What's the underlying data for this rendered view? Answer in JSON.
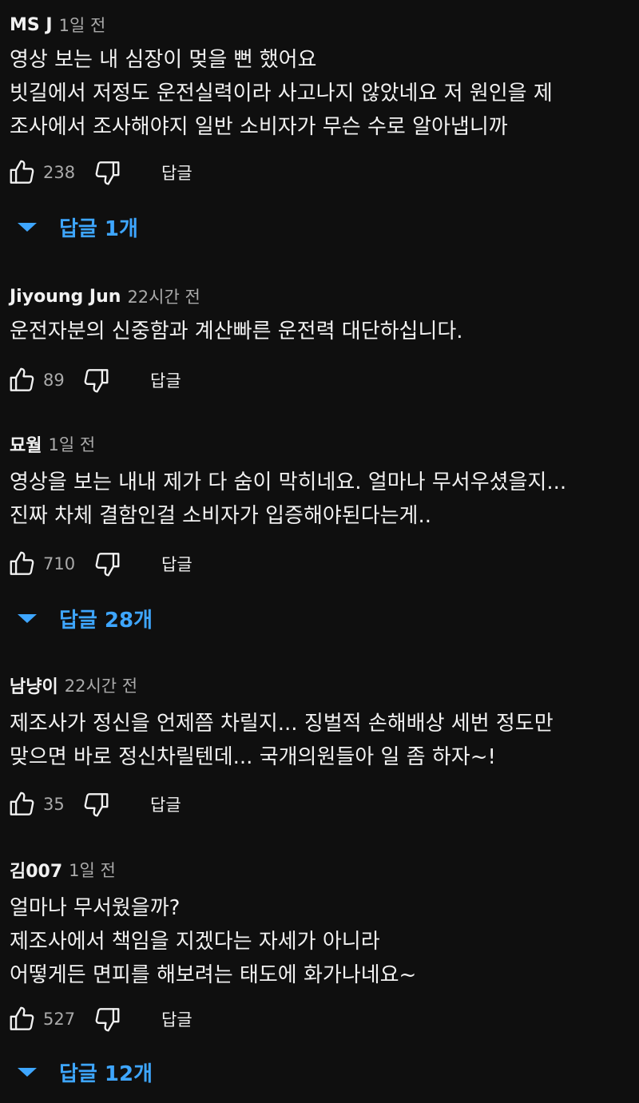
{
  "labels": {
    "reply": "답글"
  },
  "colors": {
    "background": "#0f0f0f",
    "text": "#f1f1f1",
    "secondary": "#aaaaaa",
    "link_blue": "#3ea6ff"
  },
  "icons": {
    "like": "thumbs-up-icon",
    "dislike": "thumbs-down-icon",
    "expand": "caret-down-icon"
  },
  "comments": [
    {
      "author": "MS J",
      "time": "1일 전",
      "lines": [
        "영상 보는 내 심장이 멎을 뻔 했어요",
        "빗길에서 저정도 운전실력이라 사고나지 않았네요 저 원인을 제",
        "조사에서 조사해야지 일반 소비자가 무슨 수로 알아냅니까"
      ],
      "likes": "238",
      "replies_label": "답글 1개"
    },
    {
      "author": "Jiyoung Jun",
      "time": "22시간 전",
      "lines": [
        "운전자분의 신중함과 계산빠른 운전력 대단하십니다."
      ],
      "likes": "89"
    },
    {
      "author": "묘월",
      "time": "1일 전",
      "lines": [
        "영상을 보는 내내 제가 다 숨이 막히네요. 얼마나 무서우셨을지...",
        "진짜 차체 결함인걸 소비자가 입증해야된다는게.."
      ],
      "likes": "710",
      "replies_label": "답글 28개"
    },
    {
      "author": "남냥이",
      "time": "22시간 전",
      "lines": [
        "제조사가 정신을 언제쯤 차릴지... 징벌적 손해배상 세번 정도만",
        "맞으면 바로 정신차릴텐데... 국개의원들아 일 좀 하자~!"
      ],
      "likes": "35"
    },
    {
      "author": "김007",
      "time": "1일 전",
      "lines": [
        "얼마나 무서웠을까?",
        "제조사에서 책임을 지겠다는 자세가 아니라",
        "어떻게든 면피를 해보려는 태도에 화가나네요~"
      ],
      "likes": "527",
      "replies_label": "답글 12개"
    }
  ]
}
